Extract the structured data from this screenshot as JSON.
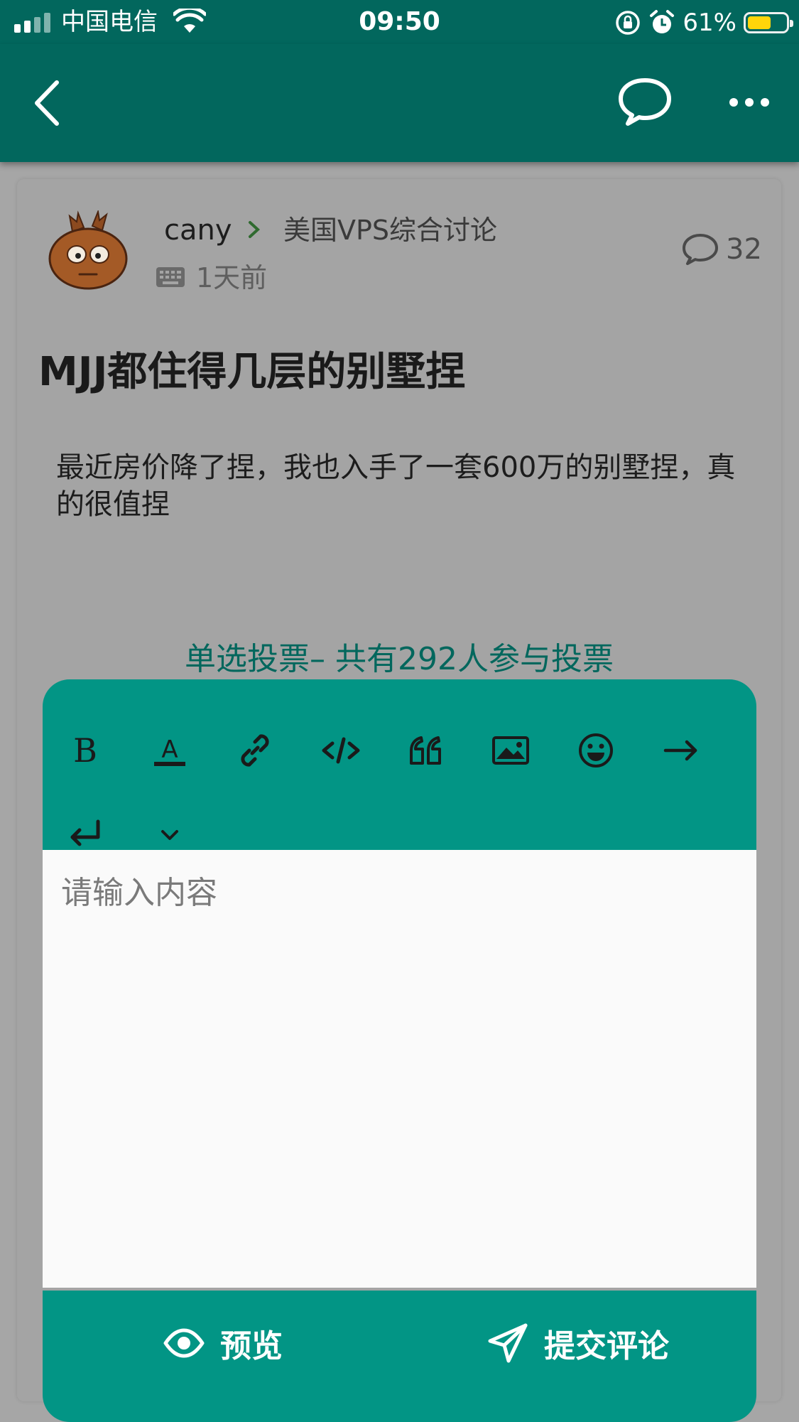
{
  "status_bar": {
    "carrier": "中国电信",
    "time": "09:50",
    "battery_percent": "61%",
    "battery_level": 0.61,
    "icons": [
      "signal-icon",
      "wifi-icon",
      "rotation-lock-icon",
      "alarm-icon",
      "battery-icon"
    ]
  },
  "app_bar": {
    "icons": [
      "back-icon",
      "chat-bubble-icon",
      "more-icon"
    ]
  },
  "post": {
    "author": "cany",
    "category": "美国VPS综合讨论",
    "time": "1天前",
    "comment_count": "32",
    "title": "MJJ都住得几层的别墅捏",
    "body": "最近房价降了捏，我也入手了一套600万的别墅捏，真的很值捏",
    "poll_title": "单选投票– 共有292人参与投票"
  },
  "editor": {
    "toolbar_buttons": [
      {
        "name": "bold",
        "icon": "bold-icon"
      },
      {
        "name": "text-color",
        "icon": "text-color-icon"
      },
      {
        "name": "link",
        "icon": "link-icon"
      },
      {
        "name": "code",
        "icon": "code-icon"
      },
      {
        "name": "quote",
        "icon": "quote-icon"
      },
      {
        "name": "image",
        "icon": "image-icon"
      },
      {
        "name": "emoji",
        "icon": "emoji-icon"
      },
      {
        "name": "indent",
        "icon": "arrow-right-icon"
      },
      {
        "name": "newline",
        "icon": "return-icon"
      },
      {
        "name": "collapse",
        "icon": "chevron-down-icon"
      }
    ],
    "placeholder": "请输入内容",
    "value": "",
    "preview_label": "预览",
    "submit_label": "提交评论"
  },
  "colors": {
    "primary_dark": "#02675d",
    "primary": "#029585",
    "battery": "#ffd50a"
  }
}
